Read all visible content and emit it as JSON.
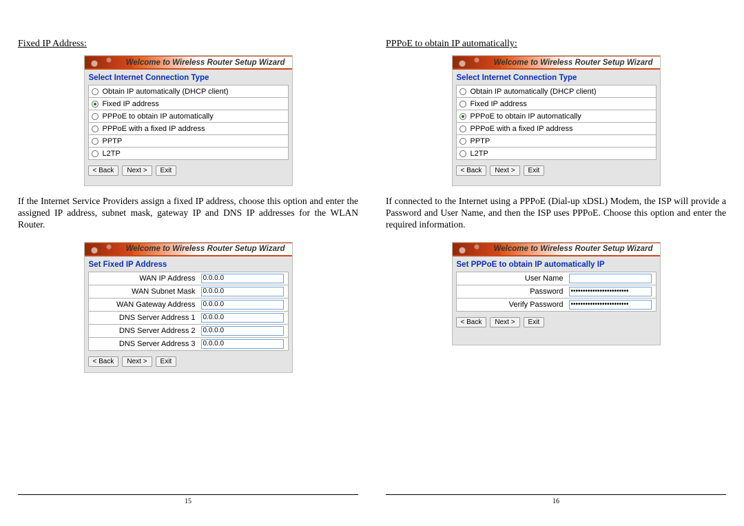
{
  "left": {
    "section_title": "Fixed IP Address:",
    "panel1": {
      "banner": "Welcome to Wireless Router Setup Wizard",
      "subhead": "Select Internet Connection Type",
      "options": [
        "Obtain IP automatically (DHCP client)",
        "Fixed IP address",
        "PPPoE to obtain IP automatically",
        "PPPoE with a fixed IP address",
        "PPTP",
        "L2TP"
      ],
      "selected_index": 1,
      "buttons": {
        "back": "< Back",
        "next": "Next >",
        "exit": "Exit"
      }
    },
    "body": "If the Internet Service Providers assign a fixed IP address, choose this option and enter the assigned IP address, subnet mask, gateway IP and DNS IP addresses for the WLAN Router.",
    "panel2": {
      "banner": "Welcome to Wireless Router Setup Wizard",
      "subhead": "Set Fixed IP Address",
      "rows": [
        {
          "label": "WAN IP Address",
          "value": "0.0.0.0"
        },
        {
          "label": "WAN Subnet Mask",
          "value": "0.0.0.0"
        },
        {
          "label": "WAN Gateway Address",
          "value": "0.0.0.0"
        },
        {
          "label": "DNS Server Address 1",
          "value": "0.0.0.0"
        },
        {
          "label": "DNS Server Address 2",
          "value": "0.0.0.0"
        },
        {
          "label": "DNS Server Address 3",
          "value": "0.0.0.0"
        }
      ],
      "buttons": {
        "back": "< Back",
        "next": "Next >",
        "exit": "Exit"
      }
    },
    "page_no": "15"
  },
  "right": {
    "section_title": "PPPoE to obtain IP automatically:",
    "panel1": {
      "banner": "Welcome to Wireless Router Setup Wizard",
      "subhead": "Select Internet Connection Type",
      "options": [
        "Obtain IP automatically (DHCP client)",
        "Fixed IP address",
        "PPPoE to obtain IP automatically",
        "PPPoE with a fixed IP address",
        "PPTP",
        "L2TP"
      ],
      "selected_index": 2,
      "buttons": {
        "back": "< Back",
        "next": "Next >",
        "exit": "Exit"
      }
    },
    "body": "If connected to the Internet using a PPPoE (Dial-up xDSL) Modem, the ISP will provide a Password and User Name, and then the ISP uses PPPoE. Choose this option and enter the required information.",
    "panel2": {
      "banner": "Welcome to Wireless Router Setup Wizard",
      "subhead": "Set PPPoE to obtain IP automatically IP",
      "rows": [
        {
          "label": "User Name",
          "value": ""
        },
        {
          "label": "Password",
          "value": "••••••••••••••••••••••••"
        },
        {
          "label": "Verify Password",
          "value": "••••••••••••••••••••••••"
        }
      ],
      "buttons": {
        "back": "< Back",
        "next": "Next >",
        "exit": "Exit"
      }
    },
    "page_no": "16"
  }
}
